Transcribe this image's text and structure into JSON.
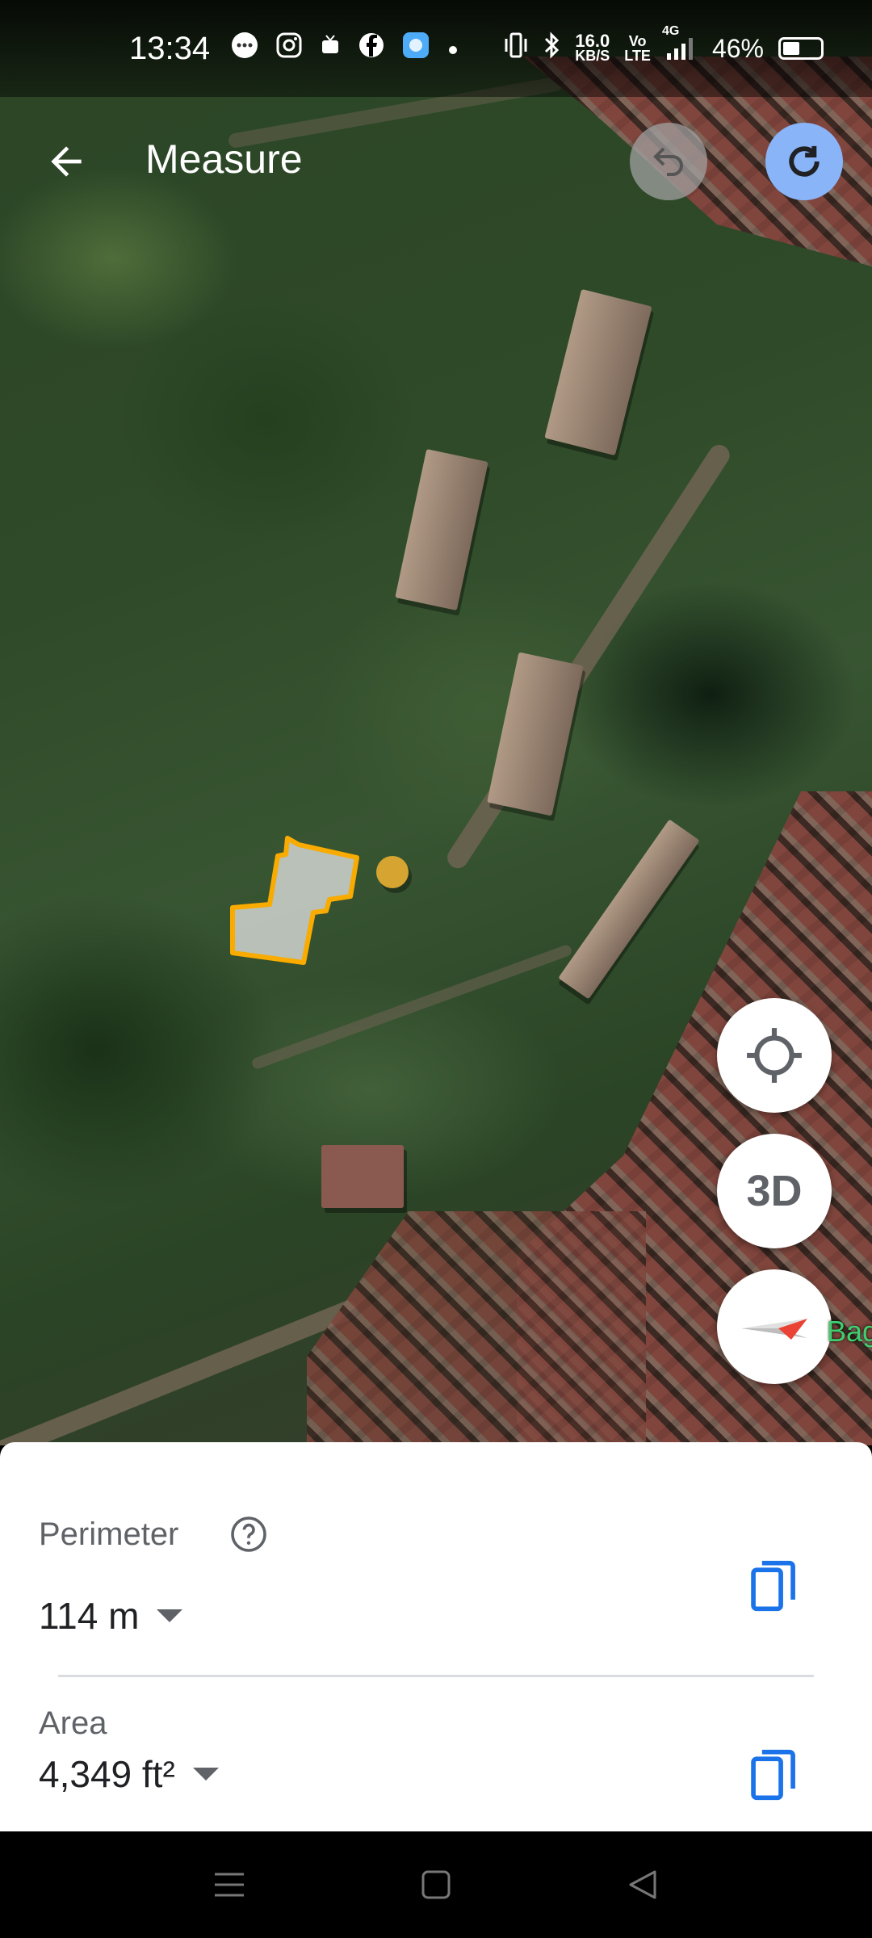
{
  "status_bar": {
    "time": "13:34",
    "speed_value": "16.0",
    "speed_unit": "KB/S",
    "volte_line1": "Vo",
    "volte_line2": "LTE",
    "network": "4G",
    "battery_percent": 46,
    "battery_text": "46%",
    "notification_icons": [
      "messages-icon",
      "instagram-icon",
      "video-icon",
      "facebook-icon",
      "app-icon",
      "dot-icon"
    ]
  },
  "header": {
    "title": "Measure",
    "back_icon": "arrow-left-icon",
    "undo_icon": "undo-icon",
    "redo_icon": "redo-icon"
  },
  "map": {
    "place_label": "Bag",
    "measure_color": "#f9ab00",
    "buttons": {
      "locate_icon": "crosshair-icon",
      "threed_label": "3D",
      "compass_icon": "compass-icon"
    }
  },
  "measurement": {
    "perimeter_label": "Perimeter",
    "perimeter_value": "114 m",
    "area_label": "Area",
    "area_value": "4,349 ft²",
    "help_icon": "help-circle-icon",
    "copy_icon": "copy-icon"
  },
  "colors": {
    "accent": "#1a73e8",
    "redo_bg": "#8ab4f8",
    "compass_red": "#ea4335"
  }
}
